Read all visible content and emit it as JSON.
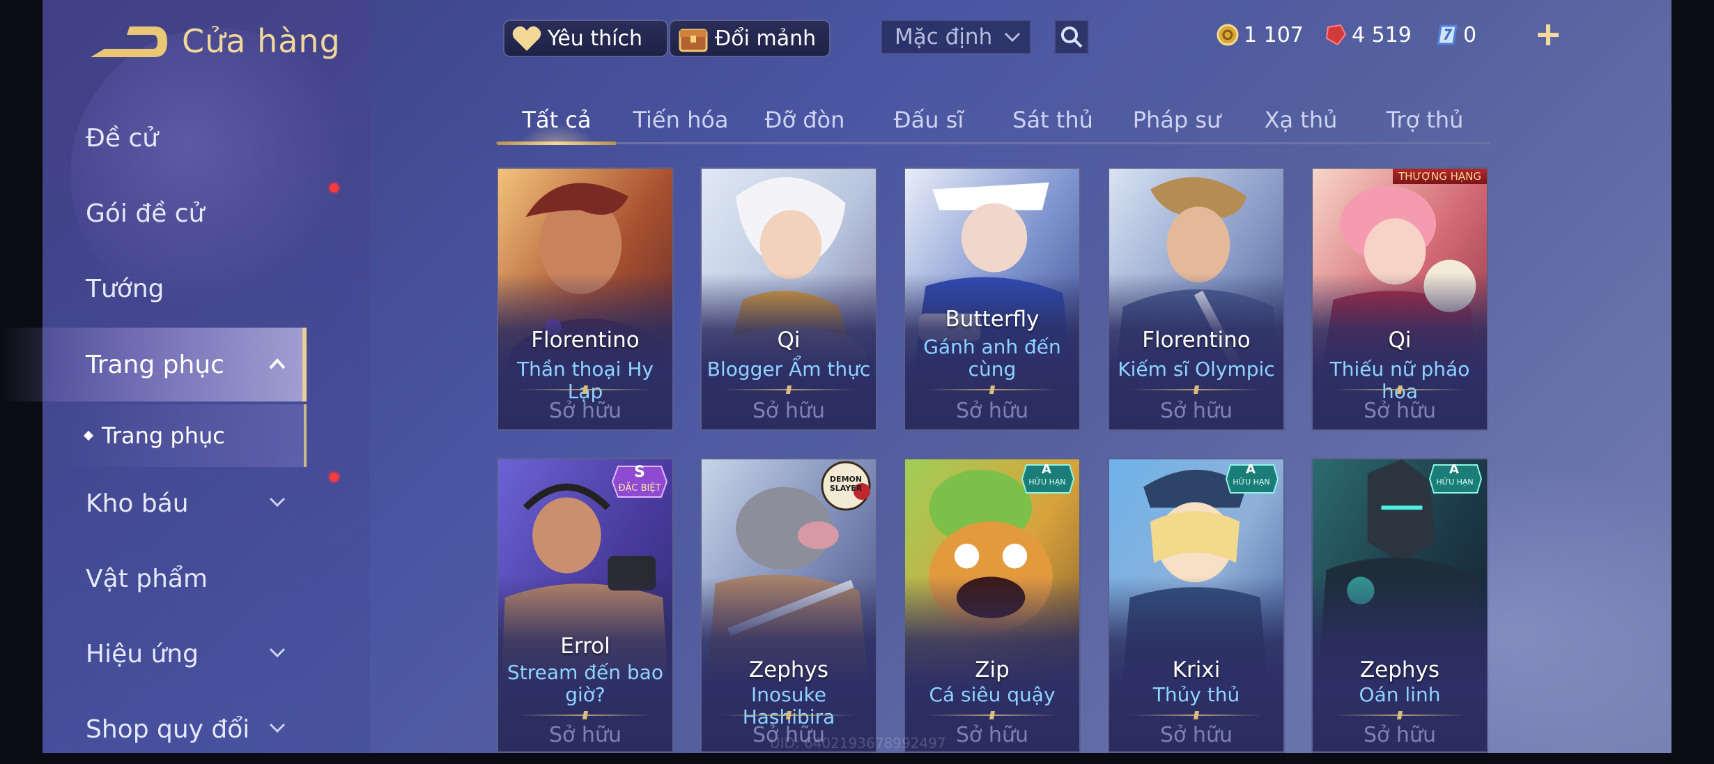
{
  "header": {
    "title": "Cửa hàng",
    "favorite_label": "Yêu thích",
    "exchange_label": "Đổi mảnh",
    "sort_value": "Mặc định"
  },
  "currencies": {
    "gold": "1 107",
    "ruby": "4 519",
    "voucher": "0"
  },
  "sidebar": {
    "items": [
      {
        "label": "Đề cử"
      },
      {
        "label": "Gói đề cử"
      },
      {
        "label": "Tướng"
      },
      {
        "label": "Trang phục"
      },
      {
        "label": "Trang phục"
      },
      {
        "label": "Kho báu"
      },
      {
        "label": "Vật phẩm"
      },
      {
        "label": "Hiệu ứng"
      },
      {
        "label": "Shop quy đổi"
      }
    ]
  },
  "tabs": [
    "Tất cả",
    "Tiến hóa",
    "Đỡ đòn",
    "Đấu sĩ",
    "Sát thủ",
    "Pháp sư",
    "Xạ thủ",
    "Trợ thủ"
  ],
  "cards": [
    {
      "hero": "Florentino",
      "skin": "Thần thoại Hy Lạp",
      "status": "Sở hữu"
    },
    {
      "hero": "Qi",
      "skin": "Blogger Ẩm thực",
      "status": "Sở hữu"
    },
    {
      "hero": "Butterfly",
      "skin": "Gánh anh đến cùng",
      "status": "Sở hữu"
    },
    {
      "hero": "Florentino",
      "skin": "Kiếm sĩ Olympic",
      "status": "Sở hữu"
    },
    {
      "hero": "Qi",
      "skin": "Thiếu nữ pháo hoa",
      "status": "Sở hữu",
      "tag": "THƯỢNG HẠNG"
    },
    {
      "hero": "Errol",
      "skin": "Stream đến bao giờ?",
      "status": "Sở hữu",
      "badge_grade": "S",
      "badge_text": "ĐẶC BIỆT"
    },
    {
      "hero": "Zephys",
      "skin": "Inosuke Hashibira",
      "status": "Sở hữu",
      "badge_text": "DEMON SLAYER"
    },
    {
      "hero": "Zip",
      "skin": "Cá siêu quậy",
      "status": "Sở hữu",
      "badge_grade": "A",
      "badge_text": "HỮU HẠN"
    },
    {
      "hero": "Krixi",
      "skin": "Thủy thủ",
      "status": "Sở hữu",
      "badge_grade": "A",
      "badge_text": "HỮU HẠN"
    },
    {
      "hero": "Zephys",
      "skin": "Oán linh",
      "status": "Sở hữu",
      "badge_grade": "A",
      "badge_text": "HỮU HẠN"
    }
  ],
  "uid": "UID: 6402193678992497",
  "colors": {
    "accent_gold": "#f2d79b",
    "skin_name": "#8fd3ff",
    "owned_text": "#7c82b2"
  }
}
